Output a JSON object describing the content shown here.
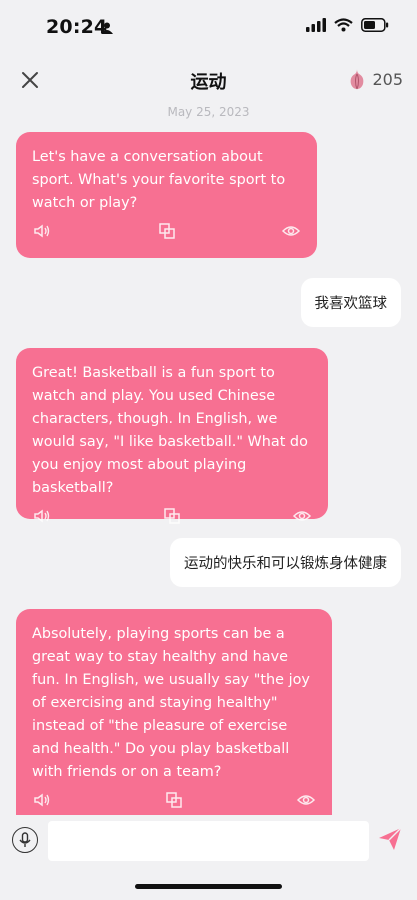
{
  "status_bar": {
    "time": "20:24"
  },
  "header": {
    "title": "运动",
    "credits": "205"
  },
  "chat": {
    "date": "May 25, 2023",
    "messages": [
      {
        "role": "assistant",
        "text": "Let's have a conversation about sport. What's your favorite sport to watch or play?"
      },
      {
        "role": "user",
        "text": "我喜欢篮球"
      },
      {
        "role": "assistant",
        "text": "Great! Basketball is a fun sport to watch and play. You used Chinese characters, though. In English, we would say, \"I like basketball.\" What do you enjoy most about playing basketball?"
      },
      {
        "role": "user",
        "text": "运动的快乐和可以锻炼身体健康"
      },
      {
        "role": "assistant",
        "text": "Absolutely, playing sports can be a great way to stay healthy and have fun. In English, we usually say \"the joy of exercising and staying healthy\" instead of \"the pleasure of exercise and health.\" Do you play basketball with friends or on a team?"
      }
    ]
  },
  "composer": {
    "placeholder": ""
  },
  "colors": {
    "assistant_bubble": "#f77092",
    "user_bubble": "#ffffff",
    "background": "#f1f1f3",
    "send": "#f77092"
  },
  "icons": [
    "person-icon",
    "signal-icon",
    "wifi-icon",
    "battery-icon",
    "close-icon",
    "onion-icon",
    "speaker-icon",
    "translate-icon",
    "eye-icon",
    "mic-icon",
    "send-icon"
  ]
}
